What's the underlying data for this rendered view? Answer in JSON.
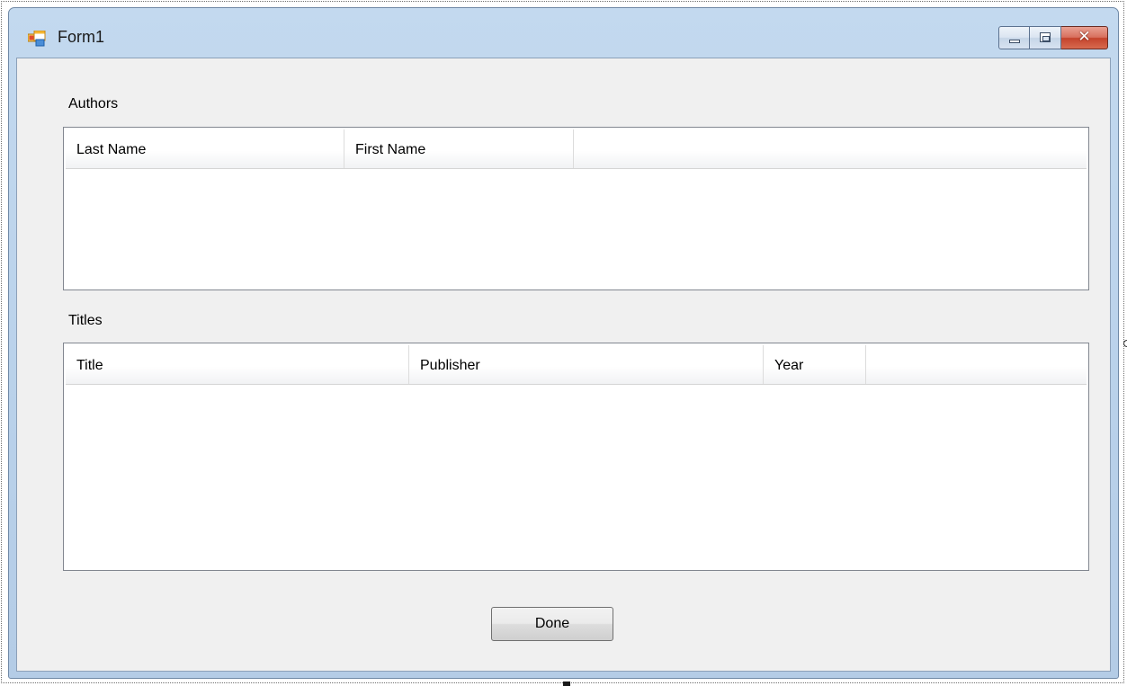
{
  "window": {
    "title": "Form1",
    "icon": "winforms-app-icon",
    "controls": {
      "minimize": "minimize-icon",
      "maximize": "maximize-icon",
      "close": "close-icon",
      "close_glyph": "✕"
    }
  },
  "authors": {
    "label": "Authors",
    "columns": [
      {
        "label": "Last Name"
      },
      {
        "label": "First Name"
      }
    ],
    "rows": []
  },
  "titles": {
    "label": "Titles",
    "columns": [
      {
        "label": "Title"
      },
      {
        "label": "Publisher"
      },
      {
        "label": "Year"
      }
    ],
    "rows": []
  },
  "actions": {
    "done_label": "Done"
  },
  "colors": {
    "client_background": "#f0f0f0",
    "titlebar": "#b9d1ea",
    "close_button": "#c4432c"
  }
}
